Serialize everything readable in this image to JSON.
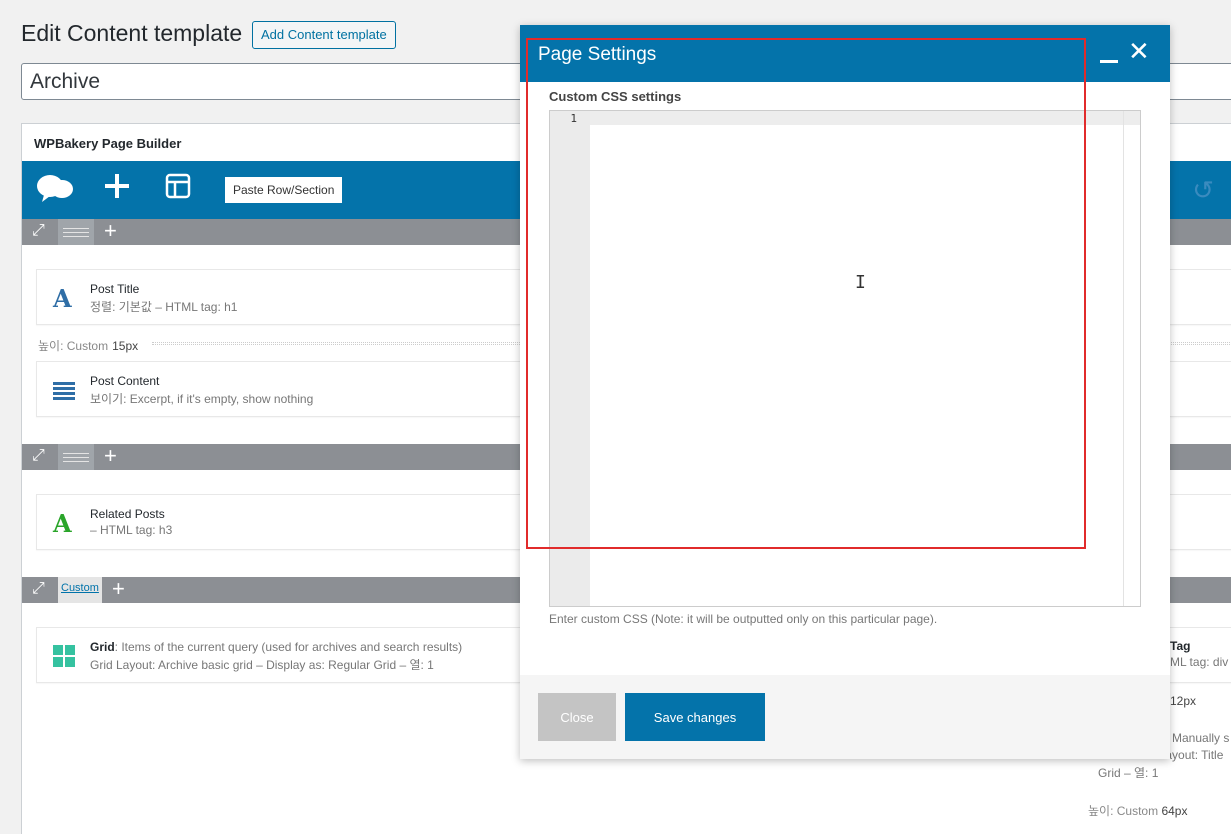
{
  "header": {
    "title": "Edit Content template",
    "add_button": "Add Content template",
    "post_title": "Archive"
  },
  "builder": {
    "title": "WPBakery Page Builder",
    "paste_button": "Paste Row/Section",
    "rows": [
      {
        "elements": [
          {
            "title": "Post Title",
            "sub": "정렬: 기본값  – HTML tag: h1"
          },
          {
            "title": "Post Content",
            "sub": "보이기: Excerpt, if it's empty, show nothing"
          }
        ],
        "spacer": {
          "label": "높이: Custom",
          "value": "15px"
        }
      },
      {
        "elements": [
          {
            "title": "Related Posts",
            "sub": "– HTML tag: h3"
          }
        ]
      },
      {
        "custom_label": "Custom",
        "elements": [
          {
            "title": "Grid",
            "title_suffix": ": Items of the current query (used for archives and search results)",
            "sub": "Grid Layout: Archive basic grid – Display as: Regular Grid – 열: 1"
          }
        ]
      }
    ],
    "right_fragments": {
      "tag": "Tag",
      "html_tag_div": "ML tag: div",
      "px12": "12px",
      "manually": "Manually s",
      "layout_title": "rid Layout: Title",
      "grid_col": "Grid – 열: 1",
      "spacer_label": "높이: Custom",
      "px64": "64px"
    }
  },
  "modal": {
    "title": "Page Settings",
    "css_label": "Custom CSS settings",
    "line_number": "1",
    "note": "Enter custom CSS (Note: it will be outputted only on this particular page).",
    "close_button": "Close",
    "save_button": "Save changes"
  },
  "colors": {
    "accent": "#0473aa",
    "highlight": "#e12b2b"
  }
}
